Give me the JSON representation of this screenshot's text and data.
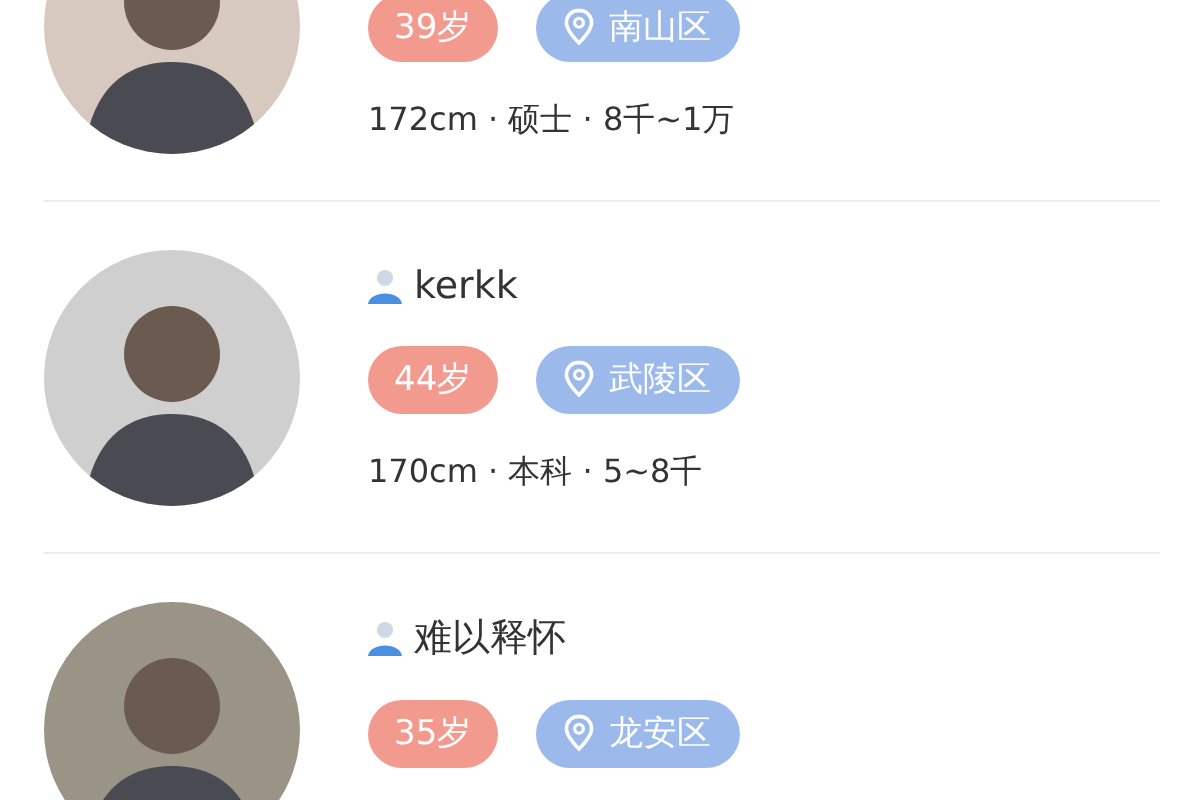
{
  "profiles": [
    {
      "age": "39岁",
      "district": "南山区",
      "details": "172cm · 硕士 · 8千~1万"
    },
    {
      "name": "kerkk",
      "age": "44岁",
      "district": "武陵区",
      "details": "170cm · 本科 · 5~8千"
    },
    {
      "name": "难以释怀",
      "age": "35岁",
      "district": "龙安区"
    }
  ]
}
